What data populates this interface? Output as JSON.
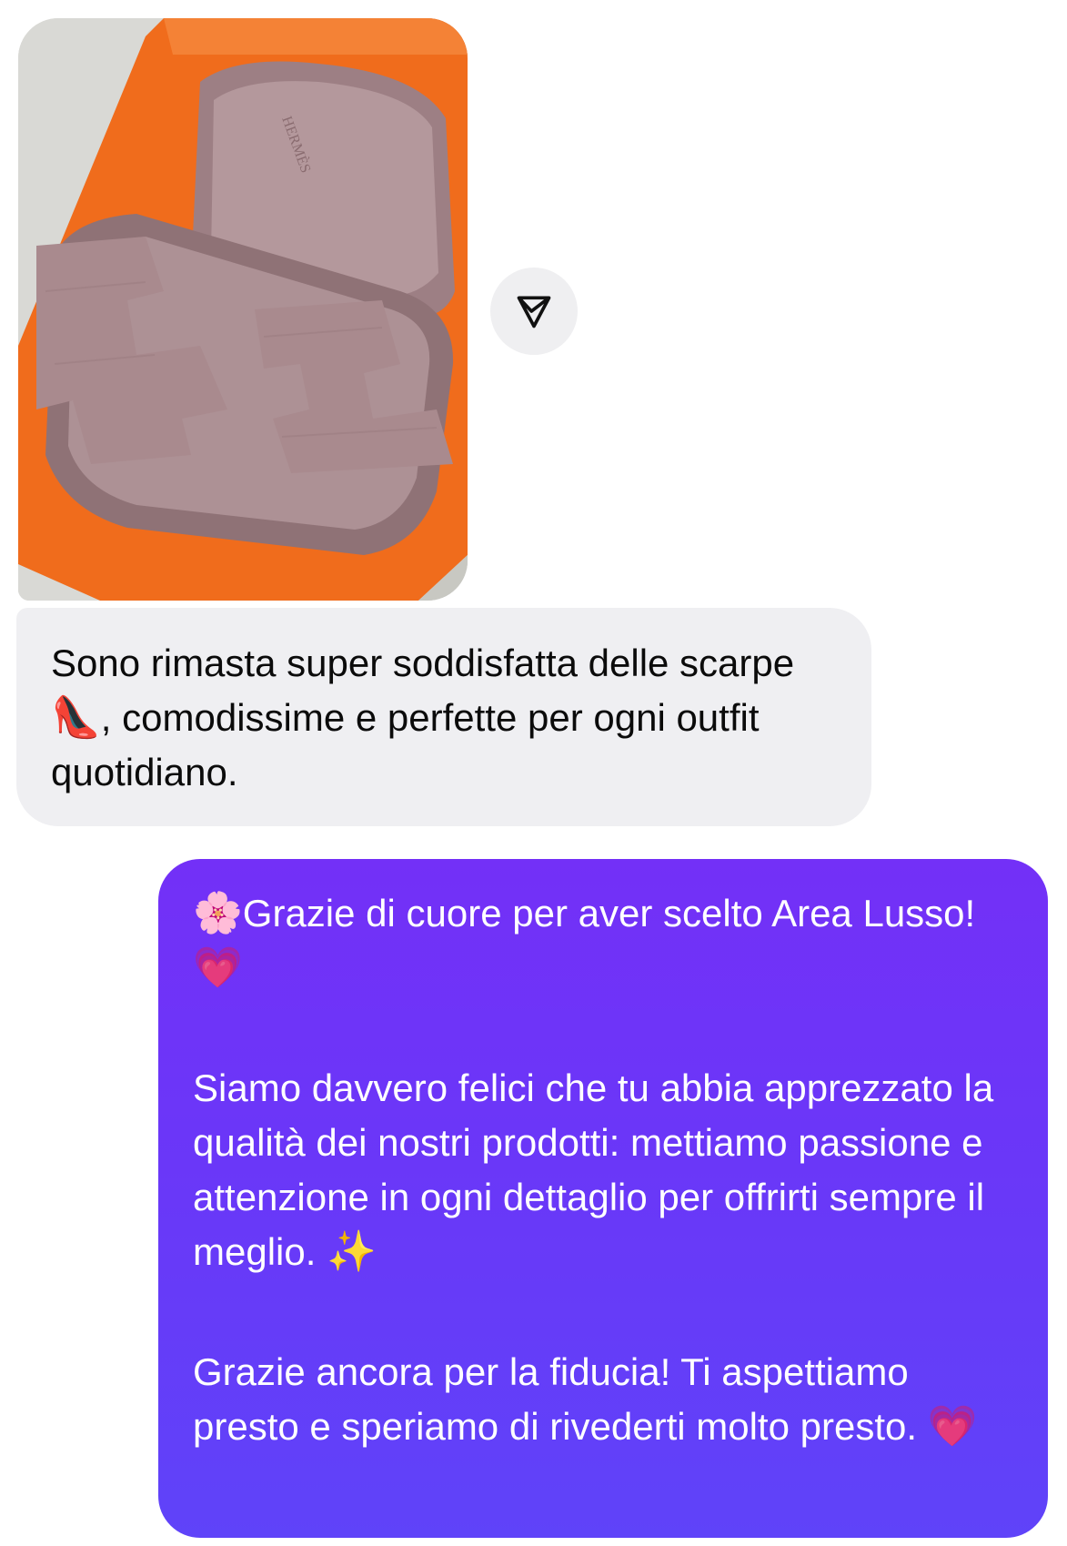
{
  "thread": {
    "photo_message": {
      "alt": "Pink suede H-strap sandals on an orange box",
      "brand_text": "HERMÈS"
    },
    "share_button": {
      "icon": "share-paper-plane-icon"
    },
    "incoming_message": {
      "text_before": "Sono rimasta super soddisfatta delle scarpe ",
      "emoji": "👠",
      "text_after": ", comodissime e perfette per ogni outfit quotidiano."
    },
    "outgoing_message": {
      "p1_emoji_start": "🌸",
      "p1_text": "Grazie di cuore per aver scelto Area Lusso!",
      "p1_emoji_end": "💗",
      "p2_text": "Siamo davvero felici che tu abbia apprezzato la qualità dei nostri prodotti: mettiamo passione e attenzione in ogni dettaglio per offrirti sempre il meglio. ",
      "p2_emoji": "✨",
      "p3_text": "Grazie ancora per la fiducia! Ti aspettiamo presto e speriamo di rivederti molto presto. ",
      "p3_emoji": "💗"
    }
  },
  "colors": {
    "incoming_bubble": "#efeff2",
    "outgoing_bubble_top": "#7330f7",
    "outgoing_bubble_bottom": "#5f43f9",
    "orange_box": "#f06c1c",
    "sandal_pink": "#a98a8e"
  }
}
